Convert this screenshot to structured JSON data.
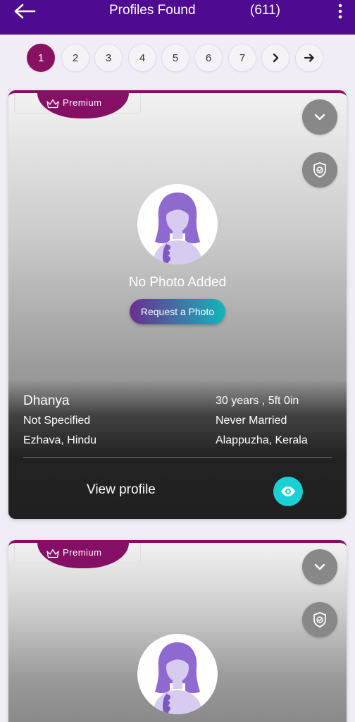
{
  "header": {
    "title": "Profiles Found",
    "count": "(611)"
  },
  "pagination": {
    "pages": [
      "1",
      "2",
      "3",
      "4",
      "5",
      "6",
      "7"
    ],
    "active": "1"
  },
  "profiles": [
    {
      "badge": "Premium",
      "no_photo_text": "No Photo Added",
      "request_button": "Request a Photo",
      "name": "Dhanya",
      "age_height": "30 years , 5ft 0in",
      "field2": "Not Specified",
      "marital_status": "Never Married",
      "community": "Ezhava, Hindu",
      "location": "Alappuzha, Kerala",
      "view_label": "View profile"
    },
    {
      "badge": "Premium"
    }
  ],
  "colors": {
    "header": "#4e0a91",
    "accent": "#8a1162",
    "teal": "#19d1d4"
  }
}
